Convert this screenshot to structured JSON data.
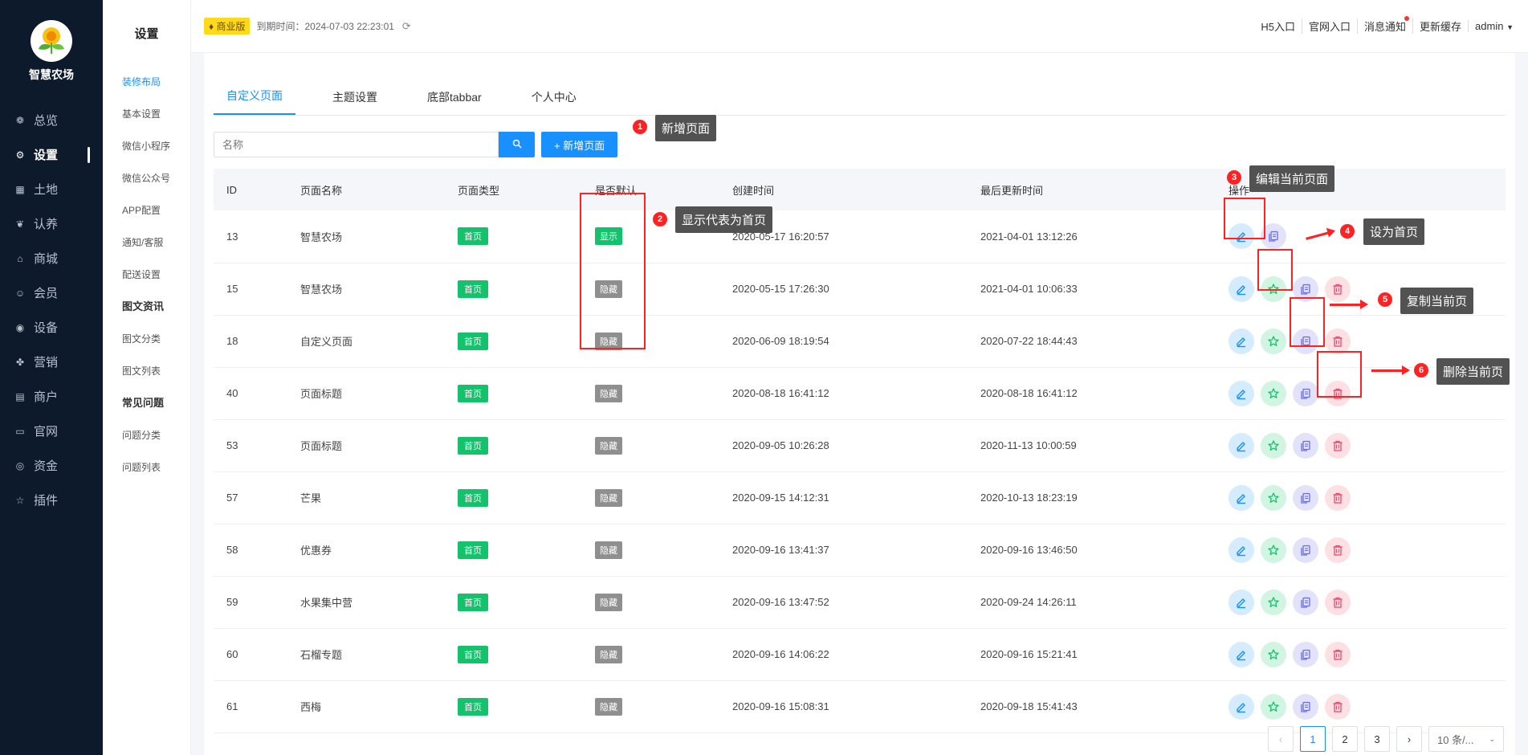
{
  "brand": {
    "name": "智慧农场"
  },
  "nav": {
    "items": [
      {
        "icon": "dashboard-icon",
        "glyph": "❁",
        "label": "总览"
      },
      {
        "icon": "gear-icon",
        "glyph": "⚙",
        "label": "设置"
      },
      {
        "icon": "grid-icon",
        "glyph": "▦",
        "label": "土地"
      },
      {
        "icon": "sprout-icon",
        "glyph": "❦",
        "label": "认养"
      },
      {
        "icon": "shop-icon",
        "glyph": "⌂",
        "label": "商城"
      },
      {
        "icon": "member-icon",
        "glyph": "☺",
        "label": "会员"
      },
      {
        "icon": "device-icon",
        "glyph": "◉",
        "label": "设备"
      },
      {
        "icon": "marketing-icon",
        "glyph": "✤",
        "label": "营销"
      },
      {
        "icon": "merchant-icon",
        "glyph": "▤",
        "label": "商户"
      },
      {
        "icon": "website-icon",
        "glyph": "▭",
        "label": "官网"
      },
      {
        "icon": "fund-icon",
        "glyph": "◎",
        "label": "资金"
      },
      {
        "icon": "plugin-icon",
        "glyph": "☆",
        "label": "插件"
      }
    ]
  },
  "subnav": {
    "title": "设置",
    "items": [
      {
        "label": "装修布局",
        "type": "active"
      },
      {
        "label": "基本设置",
        "type": "item"
      },
      {
        "label": "微信小程序",
        "type": "item"
      },
      {
        "label": "微信公众号",
        "type": "item"
      },
      {
        "label": "APP配置",
        "type": "item"
      },
      {
        "label": "通知/客服",
        "type": "item"
      },
      {
        "label": "配送设置",
        "type": "item"
      },
      {
        "label": "图文资讯",
        "type": "group"
      },
      {
        "label": "图文分类",
        "type": "item"
      },
      {
        "label": "图文列表",
        "type": "item"
      },
      {
        "label": "常见问题",
        "type": "group"
      },
      {
        "label": "问题分类",
        "type": "item"
      },
      {
        "label": "问题列表",
        "type": "item"
      }
    ]
  },
  "topbar": {
    "version": "商业版",
    "expire": "到期时间：2024-07-03 22:23:01",
    "links": [
      "H5入口",
      "官网入口",
      "消息通知",
      "更新缓存",
      "admin"
    ]
  },
  "tabs": [
    "自定义页面",
    "主题设置",
    "底部tabbar",
    "个人中心"
  ],
  "search": {
    "placeholder": "名称",
    "add_label": "+ 新增页面"
  },
  "table": {
    "headers": [
      "ID",
      "页面名称",
      "页面类型",
      "是否默认",
      "创建时间",
      "最后更新时间",
      "操作"
    ],
    "rows": [
      {
        "id": "13",
        "name": "智慧农场",
        "type": "首页",
        "default": "显示",
        "created": "2020-05-17 16:20:57",
        "updated": "2021-04-01 13:12:26",
        "isDefault": true
      },
      {
        "id": "15",
        "name": "智慧农场",
        "type": "首页",
        "default": "隐藏",
        "created": "2020-05-15 17:26:30",
        "updated": "2021-04-01 10:06:33",
        "isDefault": false
      },
      {
        "id": "18",
        "name": "自定义页面",
        "type": "首页",
        "default": "隐藏",
        "created": "2020-06-09 18:19:54",
        "updated": "2020-07-22 18:44:43",
        "isDefault": false
      },
      {
        "id": "40",
        "name": "页面标题",
        "type": "首页",
        "default": "隐藏",
        "created": "2020-08-18 16:41:12",
        "updated": "2020-08-18 16:41:12",
        "isDefault": false
      },
      {
        "id": "53",
        "name": "页面标题",
        "type": "首页",
        "default": "隐藏",
        "created": "2020-09-05 10:26:28",
        "updated": "2020-11-13 10:00:59",
        "isDefault": false
      },
      {
        "id": "57",
        "name": "芒果",
        "type": "首页",
        "default": "隐藏",
        "created": "2020-09-15 14:12:31",
        "updated": "2020-10-13 18:23:19",
        "isDefault": false
      },
      {
        "id": "58",
        "name": "优惠券",
        "type": "首页",
        "default": "隐藏",
        "created": "2020-09-16 13:41:37",
        "updated": "2020-09-16 13:46:50",
        "isDefault": false
      },
      {
        "id": "59",
        "name": "水果集中营",
        "type": "首页",
        "default": "隐藏",
        "created": "2020-09-16 13:47:52",
        "updated": "2020-09-24 14:26:11",
        "isDefault": false
      },
      {
        "id": "60",
        "name": "石榴专题",
        "type": "首页",
        "default": "隐藏",
        "created": "2020-09-16 14:06:22",
        "updated": "2020-09-16 15:21:41",
        "isDefault": false
      },
      {
        "id": "61",
        "name": "西梅",
        "type": "首页",
        "default": "隐藏",
        "created": "2020-09-16 15:08:31",
        "updated": "2020-09-18 15:41:43",
        "isDefault": false
      }
    ]
  },
  "pager": {
    "pages": [
      "1",
      "2",
      "3"
    ],
    "size": "10 条/..."
  },
  "annotations": [
    {
      "num": "1",
      "label": "新增页面"
    },
    {
      "num": "2",
      "label": "显示代表为首页"
    },
    {
      "num": "3",
      "label": "编辑当前页面"
    },
    {
      "num": "4",
      "label": "设为首页"
    },
    {
      "num": "5",
      "label": "复制当前页"
    },
    {
      "num": "6",
      "label": "删除当前页"
    }
  ],
  "colors": {
    "primary": "#1890ff",
    "success": "#13c26b",
    "annotation": "#ff2222",
    "nav_bg": "#0c1a2b"
  }
}
